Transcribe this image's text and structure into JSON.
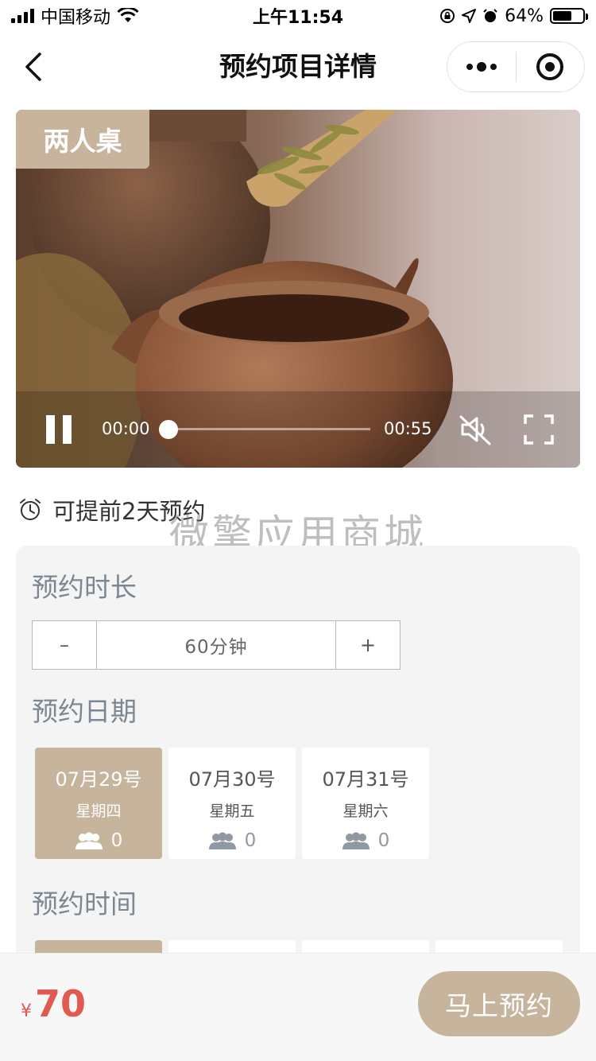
{
  "status_bar": {
    "carrier": "中国移动",
    "time": "上午11:54",
    "battery_percent": "64%",
    "battery_level": 0.64
  },
  "nav": {
    "title": "预约项目详情",
    "icons": [
      "chevron-left-icon",
      "more-dots-icon",
      "target-icon"
    ]
  },
  "video": {
    "tag": "两人桌",
    "current_time": "00:00",
    "total_time": "00:55",
    "progress": 0
  },
  "advance_note": "可提前2天预约",
  "watermark": "微擎应用商城",
  "duration": {
    "title": "预约时长",
    "minus": "–",
    "value": "60分钟",
    "plus": "+"
  },
  "date_section": {
    "title": "预约日期",
    "dates": [
      {
        "day": "07月29号",
        "week": "星期四",
        "count": "0",
        "selected": true
      },
      {
        "day": "07月30号",
        "week": "星期五",
        "count": "0",
        "selected": false
      },
      {
        "day": "07月31号",
        "week": "星期六",
        "count": "0",
        "selected": false
      }
    ]
  },
  "time_section": {
    "title": "预约时间"
  },
  "bottom": {
    "currency": "¥",
    "price": "70",
    "book_label": "马上预约"
  },
  "colors": {
    "accent": "#c7b49c",
    "price": "#e05a4f",
    "section_title": "#7b8894"
  }
}
